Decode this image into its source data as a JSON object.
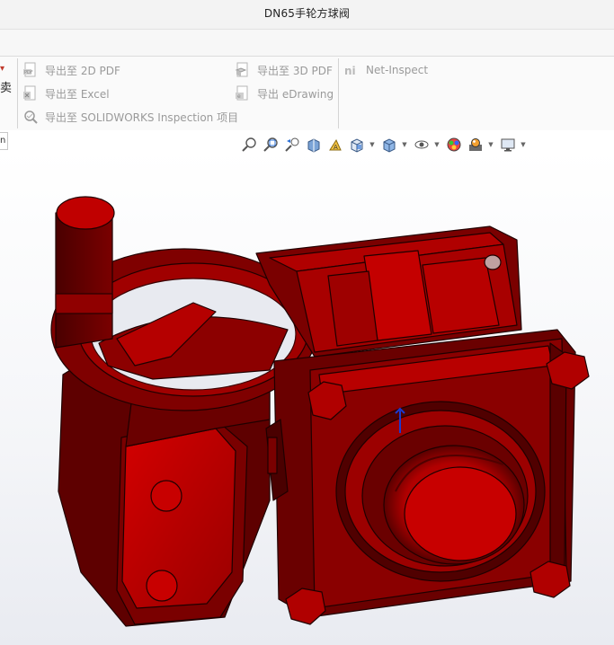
{
  "window": {
    "title": "DN65手轮方球阀"
  },
  "ribbon": {
    "left_fragment_text": "卖",
    "buttons": [
      {
        "label": "导出至 2D PDF",
        "icon": "pdf-2d-icon"
      },
      {
        "label": "导出至 Excel",
        "icon": "excel-export-icon"
      },
      {
        "label": "导出至 SOLIDWORKS Inspection 项目",
        "icon": "inspection-icon"
      },
      {
        "label": "导出至 3D PDF",
        "icon": "pdf-3d-icon"
      },
      {
        "label": "导出 eDrawing",
        "icon": "edrawing-icon"
      },
      {
        "label": "Net-Inspect",
        "icon": "net-inspect-icon"
      }
    ]
  },
  "tabs": {
    "fragment_label": "n"
  },
  "heads_up_toolbar": {
    "items": [
      "zoom-to-fit-icon",
      "zoom-to-area-icon",
      "previous-view-icon",
      "section-view-icon",
      "dynamic-annotation-icon",
      "view-orientation-icon",
      "display-style-icon",
      "hide-show-items-icon",
      "edit-appearance-icon",
      "apply-scene-icon",
      "view-settings-icon"
    ]
  },
  "model": {
    "name": "DN65手轮方球阀",
    "color": "#c00000",
    "dark_color": "#5c0000",
    "shadow_color": "#3a0000"
  }
}
